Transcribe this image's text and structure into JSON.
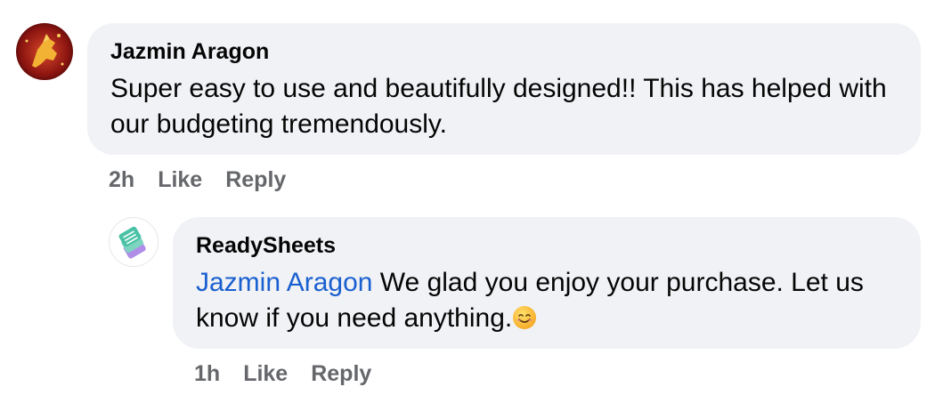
{
  "comment": {
    "author": "Jazmin Aragon",
    "text": "Super easy to use and beautifully designed!! This has helped with our budgeting tremendously.",
    "time": "2h",
    "like_label": "Like",
    "reply_label": "Reply"
  },
  "reply": {
    "author": "ReadySheets",
    "mention": "Jazmin Aragon",
    "text": " We glad you enjoy your purchase. Let us know if you need anything.",
    "emoji": "smiling-face-emoji",
    "time": "1h",
    "like_label": "Like",
    "reply_label": "Reply"
  },
  "colors": {
    "bubble": "#f0f2f5",
    "mention": "#1a5fd0",
    "meta": "#65676b"
  }
}
